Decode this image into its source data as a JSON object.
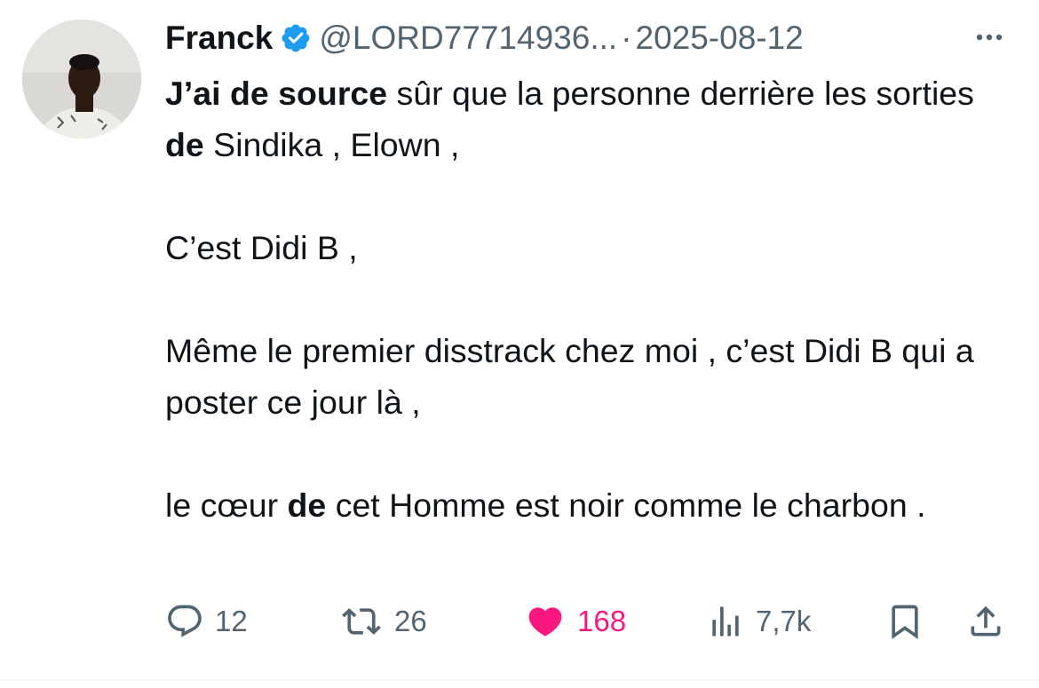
{
  "author": {
    "name": "Franck",
    "handle": "@LORD77714936...",
    "separator": "·",
    "date": "2025-08-12",
    "verified_icon": "verified-badge-icon",
    "verified_color": "#1d9bf0"
  },
  "body": {
    "p1": [
      {
        "text": "J’ai de source",
        "bold": true
      },
      {
        "text": " sûr que la personne derrière les sorties ",
        "bold": false
      },
      {
        "text": "de",
        "bold": true
      },
      {
        "text": " Sindika , Elown ,",
        "bold": false
      }
    ],
    "p2": "C’est Didi B ,",
    "p3": "Même le premier disstrack chez moi , c’est Didi B qui a poster ce jour là ,",
    "p4": [
      {
        "text": "le cœur ",
        "bold": false
      },
      {
        "text": "de",
        "bold": true
      },
      {
        "text": " cet Homme est noir comme le charbon .",
        "bold": false
      }
    ]
  },
  "actions": {
    "reply_count": "12",
    "retweet_count": "26",
    "like_count": "168",
    "views_count": "7,7k",
    "like_color": "#f91880",
    "muted_color": "#536471"
  }
}
